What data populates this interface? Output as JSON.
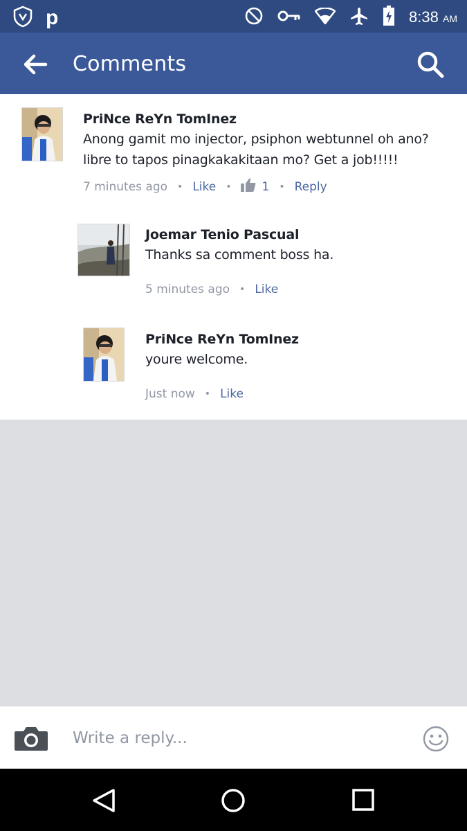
{
  "status_bar": {
    "time": "8:38",
    "ampm": "AM",
    "left_icons": [
      "shield-app-icon",
      "p-app-icon"
    ],
    "right_icons": [
      "do-not-disturb-icon",
      "vpn-key-icon",
      "wifi-icon",
      "airplane-icon",
      "battery-charging-icon"
    ],
    "p_glyph": "p"
  },
  "app_bar": {
    "title": "Comments",
    "back_icon": "arrow-back-icon",
    "search_icon": "search-icon",
    "color": "#3b5998"
  },
  "comments": [
    {
      "author": "PriNce ReYn TomInez",
      "text": "Anong gamit mo injector, psiphon webtunnel oh ano? libre to tapos pinagkakakitaan mo? Get a job!!!!!",
      "time": "7 minutes ago",
      "like_label": "Like",
      "like_count": "1",
      "reply_label": "Reply"
    },
    {
      "author": "Joemar Tenio Pascual",
      "text": "Thanks sa comment boss ha.",
      "time": "5 minutes ago",
      "like_label": "Like"
    },
    {
      "author": "PriNce ReYn TomInez",
      "text": "youre welcome.",
      "time": "Just now",
      "like_label": "Like"
    }
  ],
  "reply_bar": {
    "placeholder": "Write a reply...",
    "camera_icon": "camera-icon",
    "emoji_icon": "emoji-icon"
  },
  "nav_bar": {
    "icons": [
      "nav-back-icon",
      "nav-home-icon",
      "nav-recents-icon"
    ]
  },
  "colors": {
    "accent": "#3b5998",
    "status_bar": "#2f4a80",
    "link": "#4b67a1",
    "muted": "#9197a3",
    "background": "#dcdee2"
  }
}
